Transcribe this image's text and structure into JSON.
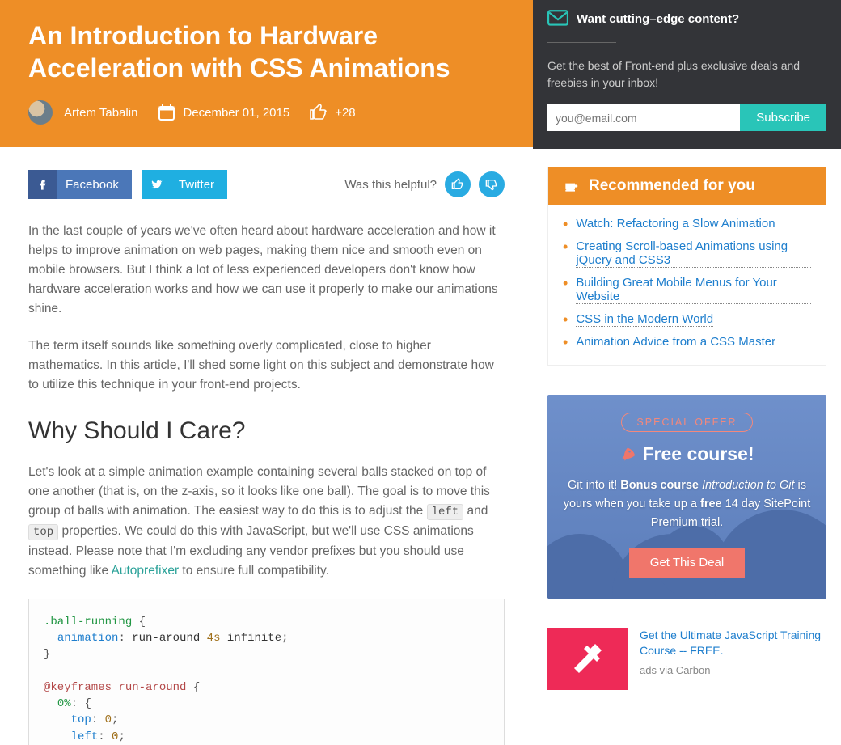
{
  "hero": {
    "title": "An Introduction to Hardware Acceleration with CSS Animations",
    "author": "Artem Tabalin",
    "date": "December 01, 2015",
    "likes": "+28"
  },
  "share": {
    "facebook": "Facebook",
    "twitter": "Twitter",
    "helpful_label": "Was this helpful?"
  },
  "article": {
    "p1": "In the last couple of years we've often heard about hardware acceleration and how it helps to improve animation on web pages, making them nice and smooth even on mobile browsers. But I think a lot of less experienced developers don't know how hardware acceleration works and how we can use it properly to make our animations shine.",
    "p2": "The term itself sounds like something overly complicated, close to higher mathematics. In this article, I'll shed some light on this subject and demonstrate how to utilize this technique in your front-end projects.",
    "h2": "Why Should I Care?",
    "p3a": "Let's look at a simple animation example containing several balls stacked on top of one another (that is, on the z-axis, so it looks like one ball). The goal is to move this group of balls with animation. The easiest way to do this is to adjust the ",
    "p3_code1": "left",
    "p3b": " and ",
    "p3_code2": "top",
    "p3c": " properties. We could do this with JavaScript, but we'll use CSS animations instead. Please note that I'm excluding any vendor prefixes but you should use something like ",
    "p3_link": "Autoprefixer",
    "p3d": " to ensure full compatibility."
  },
  "newsletter": {
    "heading": "Want cutting–edge content?",
    "sub": "Get the best of Front-end plus exclusive deals and freebies in your inbox!",
    "placeholder": "you@email.com",
    "button": "Subscribe"
  },
  "recommended": {
    "heading": "Recommended for you",
    "items": [
      "Watch: Refactoring a Slow Animation",
      "Creating Scroll-based Animations using jQuery and CSS3",
      "Building Great Mobile Menus for Your Website",
      "CSS in the Modern World",
      "Animation Advice from a CSS Master"
    ]
  },
  "offer": {
    "badge": "SPECIAL OFFER",
    "title": "Free course!",
    "text_a": "Git into it! ",
    "text_bold": "Bonus course",
    "text_ital": " Introduction to Git ",
    "text_b": "is yours when you take up a ",
    "text_bold2": "free",
    "text_c": " 14 day SitePoint Premium trial.",
    "button": "Get This Deal"
  },
  "ad": {
    "text": "Get the Ultimate JavaScript Training Course -- FREE.",
    "via": "ads via Carbon"
  }
}
